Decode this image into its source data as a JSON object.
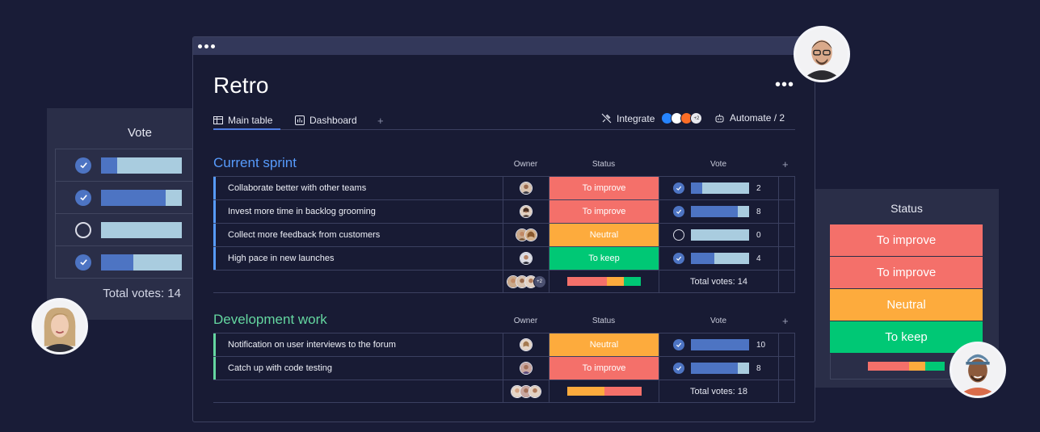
{
  "colors": {
    "background": "#191c37",
    "to_improve": "#f4706a",
    "neutral": "#fdab3d",
    "to_keep": "#00c875",
    "vote_fill": "#4d74c3",
    "vote_empty": "#a9ccdf",
    "sprint_accent": "#579bfc",
    "dev_accent": "#64d6a0"
  },
  "vote_card": {
    "title": "Vote",
    "rows": [
      {
        "voted": true,
        "fill": 0.2
      },
      {
        "voted": true,
        "fill": 0.8
      },
      {
        "voted": false,
        "fill": 0.0
      },
      {
        "voted": true,
        "fill": 0.4
      }
    ],
    "total": "Total votes: 14"
  },
  "status_card": {
    "title": "Status",
    "items": [
      "To improve",
      "To improve",
      "Neutral",
      "To keep"
    ]
  },
  "board": {
    "title": "Retro",
    "more": "•••",
    "tabs": {
      "main": "Main table",
      "dashboard": "Dashboard",
      "add": "+"
    },
    "integrate": "Integrate",
    "integrate_more": "+2",
    "automate": "Automate / 2"
  },
  "groups": [
    {
      "title": "Current sprint",
      "columns": {
        "owner": "Owner",
        "status": "Status",
        "vote": "Vote",
        "add": "+"
      },
      "rows": [
        {
          "name": "Collaborate better with other teams",
          "status": "To improve",
          "voted": true,
          "votes": "2",
          "fill": 0.2
        },
        {
          "name": "Invest more time in backlog grooming",
          "status": "To improve",
          "voted": true,
          "votes": "8",
          "fill": 0.8
        },
        {
          "name": "Collect more feedback from customers",
          "status": "Neutral",
          "voted": false,
          "votes": "0",
          "fill": 0.0
        },
        {
          "name": "High pace in new  launches",
          "status": "To keep",
          "voted": true,
          "votes": "4",
          "fill": 0.4
        }
      ],
      "owner_more": "+2",
      "total": "Total votes: 14"
    },
    {
      "title": "Development work",
      "columns": {
        "owner": "Owner",
        "status": "Status",
        "vote": "Vote",
        "add": "+"
      },
      "rows": [
        {
          "name": "Notification on user interviews to the forum",
          "status": "Neutral",
          "voted": true,
          "votes": "10",
          "fill": 1.0
        },
        {
          "name": "Catch up with code testing",
          "status": "To improve",
          "voted": true,
          "votes": "8",
          "fill": 0.8
        }
      ],
      "total": "Total votes: 18"
    }
  ]
}
